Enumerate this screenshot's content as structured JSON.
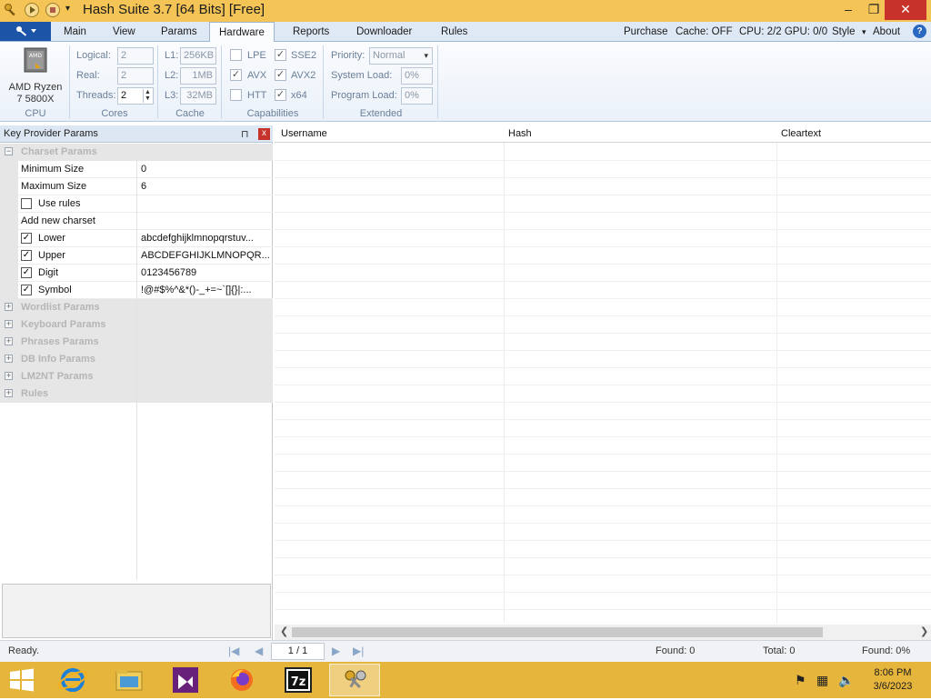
{
  "window": {
    "title": "Hash Suite 3.7 [64 Bits] [Free]",
    "minimize": "–",
    "restore": "❐",
    "close": "✕"
  },
  "ribbon_tabs": [
    "Main",
    "View",
    "Params",
    "Hardware",
    "Reports",
    "Downloader",
    "Rules"
  ],
  "active_tab": "Hardware",
  "ribbon_right": {
    "purchase": "Purchase",
    "cache": "Cache: OFF",
    "cpu_gpu": "CPU: 2/2 GPU: 0/0",
    "style": "Style",
    "about": "About",
    "help": "?"
  },
  "hardware": {
    "cpu": {
      "chip_label": "AMD",
      "name_line1": "AMD Ryzen",
      "name_line2": "7 5800X",
      "group_label": "CPU"
    },
    "cores": {
      "logical_label": "Logical:",
      "logical_value": "2",
      "real_label": "Real:",
      "real_value": "2",
      "threads_label": "Threads:",
      "threads_value": "2",
      "group_label": "Cores"
    },
    "cache": {
      "l1_label": "L1:",
      "l1_value": "256KB",
      "l2_label": "L2:",
      "l2_value": "1MB",
      "l3_label": "L3:",
      "l3_value": "32MB",
      "group_label": "Cache"
    },
    "capabilities": {
      "lpe": "LPE",
      "sse2": "SSE2",
      "avx": "AVX",
      "avx2": "AVX2",
      "htt": "HTT",
      "x64": "x64",
      "group_label": "Capabilities"
    },
    "extended": {
      "priority_label": "Priority:",
      "priority_value": "Normal",
      "system_load_label": "System Load:",
      "system_load_value": "0%",
      "program_load_label": "Program Load:",
      "program_load_value": "0%",
      "group_label": "Extended"
    }
  },
  "left_panel": {
    "title": "Key Provider Params",
    "pin": "⊓",
    "close": "x",
    "charset_header": "Charset Params",
    "rows": {
      "min_size": {
        "name": "Minimum Size",
        "value": "0"
      },
      "max_size": {
        "name": "Maximum Size",
        "value": "6"
      },
      "use_rules": {
        "name": "Use rules"
      },
      "add_charset": {
        "name": "Add new charset"
      },
      "lower": {
        "name": "Lower",
        "value": "abcdefghijklmnopqrstuv..."
      },
      "upper": {
        "name": "Upper",
        "value": "ABCDEFGHIJKLMNOPQR..."
      },
      "digit": {
        "name": "Digit",
        "value": "0123456789"
      },
      "symbol": {
        "name": "Symbol",
        "value": " !@#$%^&*()-_+=~`[]{}|:..."
      }
    },
    "categories": [
      "Wordlist Params",
      "Keyboard Params",
      "Phrases Params",
      "DB Info Params",
      "LM2NT Params",
      "Rules"
    ]
  },
  "grid": {
    "columns": [
      "Username",
      "Hash",
      "Cleartext"
    ]
  },
  "status": {
    "ready": "Ready.",
    "page": "1 / 1",
    "found_left": "Found: 0",
    "total": "Total: 0",
    "found_pct": "Found: 0%",
    "first": "|◀",
    "prev": "◀",
    "next": "▶",
    "last": "▶|"
  },
  "taskbar": {
    "time": "8:06 PM",
    "date": "3/6/2023",
    "sevenzip_label": "7z"
  },
  "colors": {
    "title_bar": "#f4c556",
    "taskbar": "#e6b53c",
    "app_menu": "#1c54a8",
    "close_red": "#c7332b"
  }
}
